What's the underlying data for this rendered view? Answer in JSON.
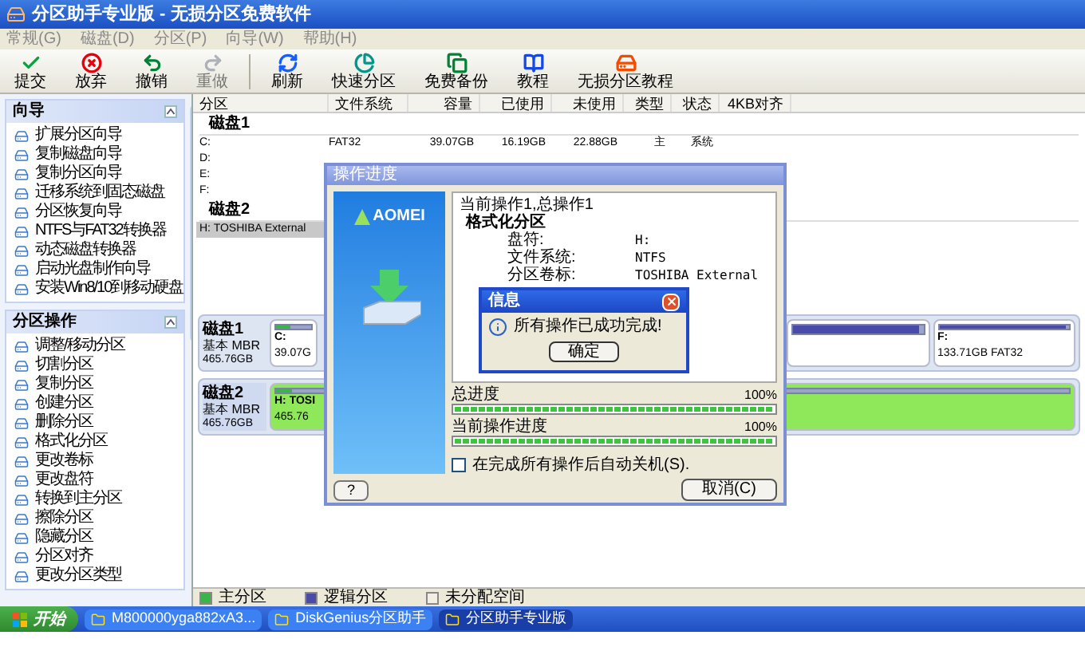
{
  "window": {
    "title": "分区助手专业版 - 无损分区免费软件"
  },
  "menu": [
    "常规(G)",
    "磁盘(D)",
    "分区(P)",
    "向导(W)",
    "帮助(H)"
  ],
  "toolbar": [
    {
      "label": "提交",
      "kind": "commit",
      "disabled": false
    },
    {
      "label": "放弃",
      "kind": "discard",
      "disabled": false
    },
    {
      "label": "撤销",
      "kind": "undo",
      "disabled": false
    },
    {
      "label": "重做",
      "kind": "redo",
      "disabled": true
    },
    {
      "label": "刷新",
      "kind": "refresh",
      "disabled": false
    },
    {
      "label": "快速分区",
      "kind": "quick",
      "disabled": false
    },
    {
      "label": "免费备份",
      "kind": "backup",
      "disabled": false
    },
    {
      "label": "教程",
      "kind": "tutorial",
      "disabled": false
    },
    {
      "label": "无损分区教程",
      "kind": "guide",
      "disabled": false
    }
  ],
  "sidebar": [
    {
      "title": "向导",
      "expanded": true,
      "items": [
        "扩展分区向导",
        "复制磁盘向导",
        "复制分区向导",
        "迁移系统到固态磁盘",
        "分区恢复向导",
        "NTFS与FAT32转换器",
        "动态磁盘转换器",
        "启动光盘制作向导",
        "安装Win8/10到移动硬盘"
      ]
    },
    {
      "title": "分区操作",
      "expanded": true,
      "items": [
        "调整/移动分区",
        "切割分区",
        "复制分区",
        "创建分区",
        "删除分区",
        "格式化分区",
        "更改卷标",
        "更改盘符",
        "转换到主分区",
        "擦除分区",
        "隐藏分区",
        "分区对齐",
        "更改分区类型"
      ]
    }
  ],
  "table": {
    "columns": [
      "分区",
      "文件系统",
      "容量",
      "已使用",
      "未使用",
      "类型",
      "状态",
      "4KB对齐"
    ],
    "groups": [
      {
        "title": "磁盘1",
        "rows": [
          {
            "cells": [
              "C:",
              "FAT32",
              "39.07GB",
              "16.19GB",
              "22.88GB",
              "主",
              "系统"
            ],
            "selected": false
          },
          {
            "cells": [
              "D:"
            ],
            "selected": false
          },
          {
            "cells": [
              "E:"
            ],
            "selected": false
          },
          {
            "cells": [
              "F:"
            ],
            "selected": false
          }
        ]
      },
      {
        "title": "磁盘2",
        "rows": [
          {
            "cells": [
              "H: TOSHIBA External"
            ],
            "selected": true
          }
        ]
      }
    ]
  },
  "disk_map": [
    {
      "name": "磁盘1",
      "type": "基本 MBR",
      "size": "465.76GB",
      "selected": false,
      "partitions": [
        {
          "kind": "primary",
          "label": "C:",
          "detail": "39.07G",
          "level": 0.42,
          "selected": false
        },
        {
          "kind": "logical",
          "level": 0.97,
          "selected": false
        },
        {
          "kind": "logical",
          "label": "F:",
          "detail": "133.71GB FAT32",
          "level": 0.97,
          "selected": false
        }
      ]
    },
    {
      "name": "磁盘2",
      "type": "基本 MBR",
      "size": "465.76GB",
      "selected": true,
      "partitions": [
        {
          "kind": "primary",
          "label": "H: TOSI",
          "detail": "465.76",
          "level": 0.02,
          "selected": true
        }
      ]
    }
  ],
  "legend": [
    {
      "label": "主分区",
      "kind": "primary"
    },
    {
      "label": "逻辑分区",
      "kind": "logical"
    },
    {
      "label": "未分配空间",
      "kind": "unallocated"
    }
  ],
  "progress_dialog": {
    "title": "操作进度",
    "logo": "AOMEI",
    "summary": "当前操作1,总操作1",
    "operation": "格式化分区",
    "details": [
      {
        "label": "盘符:",
        "value": "H:"
      },
      {
        "label": "文件系统:",
        "value": "NTFS"
      },
      {
        "label": "分区卷标:",
        "value": "TOSHIBA External"
      }
    ],
    "bars": [
      {
        "label": "总进度",
        "reading": "100%",
        "level": 1
      },
      {
        "label": "当前操作进度",
        "reading": "100%",
        "level": 1
      }
    ],
    "shutdown_option": {
      "label": "在完成所有操作后自动关机(S).",
      "checked": false
    },
    "help": "?",
    "cancel": "取消(C)"
  },
  "info_dialog": {
    "title": "信息",
    "message": "所有操作已成功完成!",
    "ok": "确定"
  },
  "taskbar": {
    "start": "开始",
    "items": [
      {
        "label": "M800000yga882xA3...",
        "selected": false
      },
      {
        "label": "DiskGenius分区助手",
        "selected": false
      },
      {
        "label": "分区助手专业版",
        "selected": true
      }
    ]
  }
}
